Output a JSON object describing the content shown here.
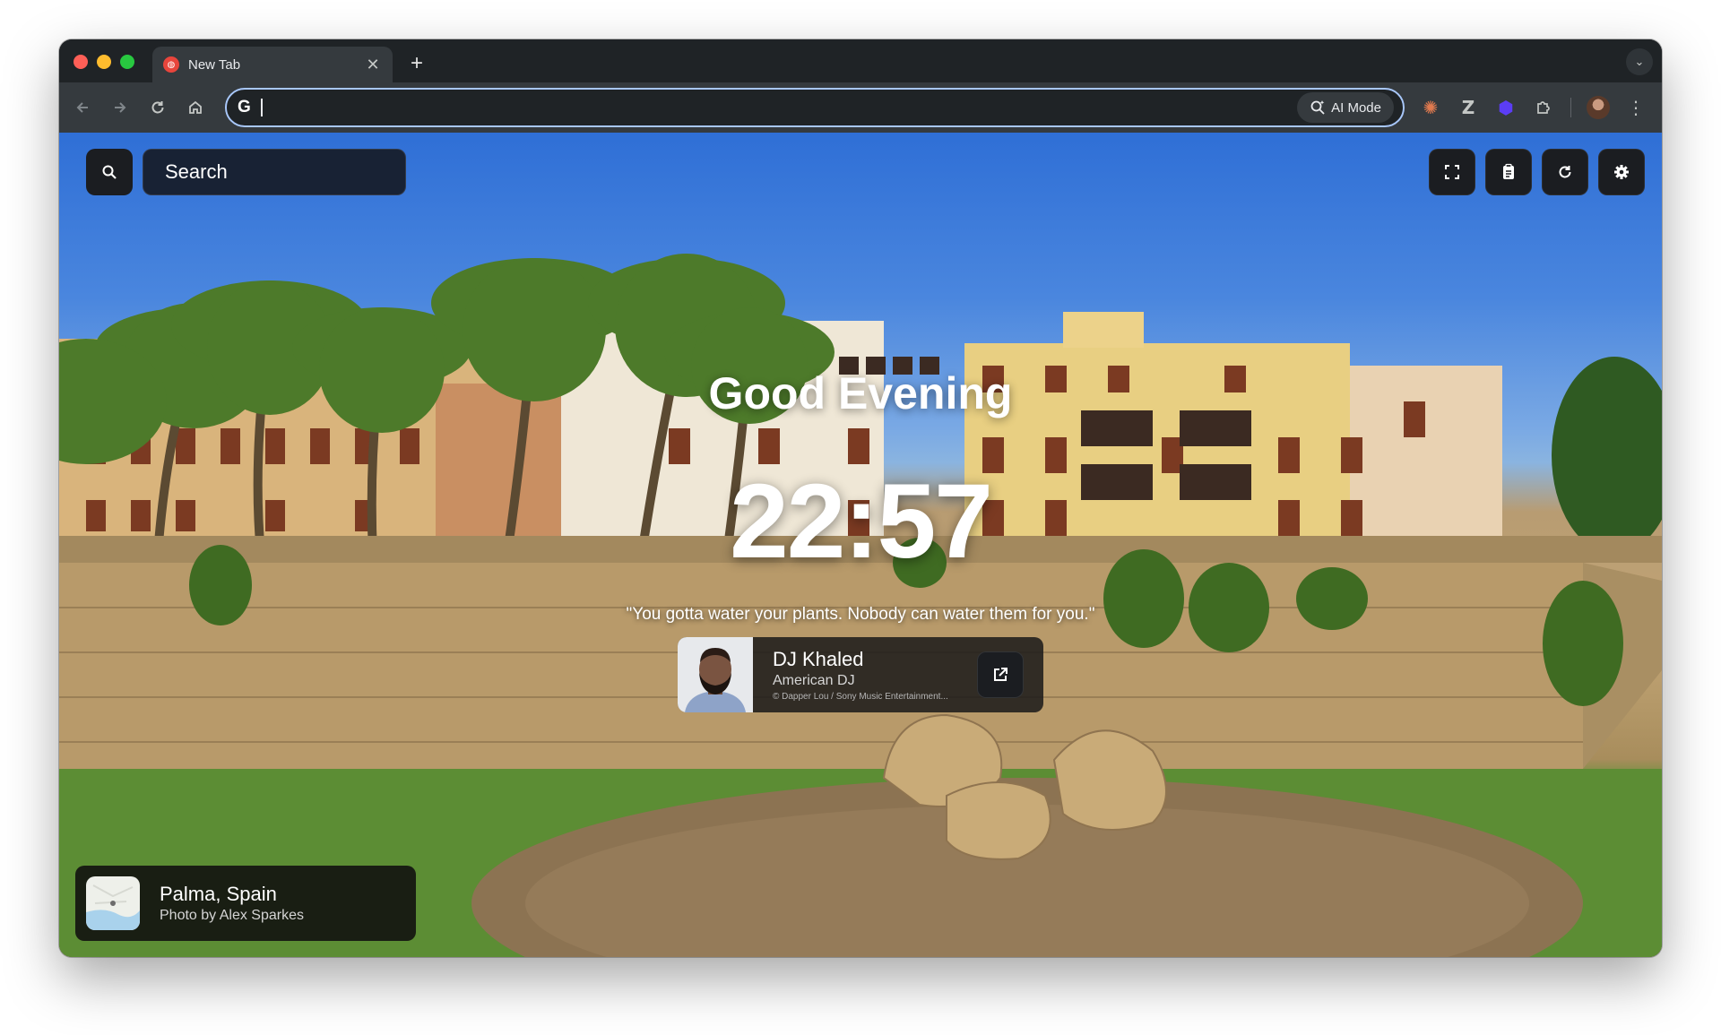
{
  "browser": {
    "tab": {
      "title": "New Tab"
    },
    "omnibox": {
      "value": "",
      "ai_mode_label": "AI Mode"
    }
  },
  "newtab": {
    "search": {
      "placeholder": "Search"
    },
    "greeting": "Good Evening",
    "time": "22:57",
    "quote": {
      "text": "\"You gotta water your plants. Nobody can water them for you.\"",
      "author": "DJ Khaled",
      "author_description": "American DJ",
      "photo_credit": "© Dapper Lou / Sony Music Entertainment..."
    },
    "location": {
      "place": "Palma, Spain",
      "credit": "Photo by Alex Sparkes"
    },
    "controls": [
      "fullscreen-icon",
      "clipboard-icon",
      "refresh-icon",
      "settings-icon"
    ]
  },
  "colors": {
    "window_frame": "#1f2326",
    "toolbar": "#353a3e",
    "omnibox_focus": "#a8c7fa",
    "card_bg": "#1b1d21"
  }
}
